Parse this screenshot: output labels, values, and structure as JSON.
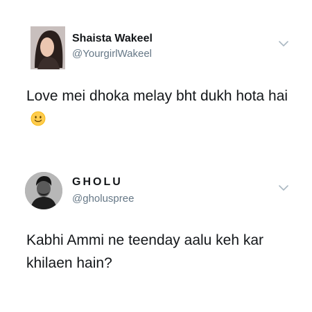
{
  "tweets": [
    {
      "display_name": "Shaista Wakeel",
      "handle": "@YourgirlWakeel",
      "text": "Love mei dhoka melay bht dukh hota hai",
      "emoji": "slightly-smiling-face-icon"
    },
    {
      "display_name": "GHOLU",
      "handle": "@gholuspree",
      "text": "Kabhi Ammi ne teenday aalu keh kar khilaen hain?"
    }
  ],
  "colors": {
    "text_primary": "#14171a",
    "text_secondary": "#657786",
    "chevron": "#aab8c2",
    "background": "#ffffff"
  }
}
